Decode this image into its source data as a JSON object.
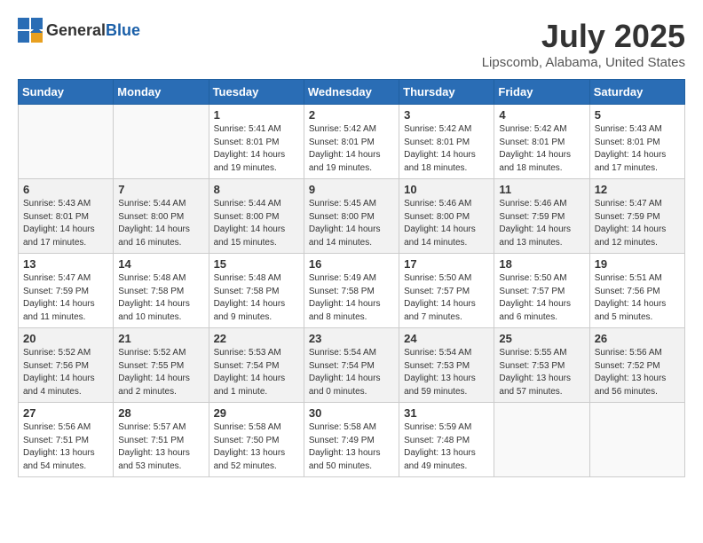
{
  "header": {
    "logo_general": "General",
    "logo_blue": "Blue",
    "title": "July 2025",
    "location": "Lipscomb, Alabama, United States"
  },
  "weekdays": [
    "Sunday",
    "Monday",
    "Tuesday",
    "Wednesday",
    "Thursday",
    "Friday",
    "Saturday"
  ],
  "weeks": [
    [
      {
        "day": "",
        "sunrise": "",
        "sunset": "",
        "daylight": ""
      },
      {
        "day": "",
        "sunrise": "",
        "sunset": "",
        "daylight": ""
      },
      {
        "day": "1",
        "sunrise": "Sunrise: 5:41 AM",
        "sunset": "Sunset: 8:01 PM",
        "daylight": "Daylight: 14 hours and 19 minutes."
      },
      {
        "day": "2",
        "sunrise": "Sunrise: 5:42 AM",
        "sunset": "Sunset: 8:01 PM",
        "daylight": "Daylight: 14 hours and 19 minutes."
      },
      {
        "day": "3",
        "sunrise": "Sunrise: 5:42 AM",
        "sunset": "Sunset: 8:01 PM",
        "daylight": "Daylight: 14 hours and 18 minutes."
      },
      {
        "day": "4",
        "sunrise": "Sunrise: 5:42 AM",
        "sunset": "Sunset: 8:01 PM",
        "daylight": "Daylight: 14 hours and 18 minutes."
      },
      {
        "day": "5",
        "sunrise": "Sunrise: 5:43 AM",
        "sunset": "Sunset: 8:01 PM",
        "daylight": "Daylight: 14 hours and 17 minutes."
      }
    ],
    [
      {
        "day": "6",
        "sunrise": "Sunrise: 5:43 AM",
        "sunset": "Sunset: 8:01 PM",
        "daylight": "Daylight: 14 hours and 17 minutes."
      },
      {
        "day": "7",
        "sunrise": "Sunrise: 5:44 AM",
        "sunset": "Sunset: 8:00 PM",
        "daylight": "Daylight: 14 hours and 16 minutes."
      },
      {
        "day": "8",
        "sunrise": "Sunrise: 5:44 AM",
        "sunset": "Sunset: 8:00 PM",
        "daylight": "Daylight: 14 hours and 15 minutes."
      },
      {
        "day": "9",
        "sunrise": "Sunrise: 5:45 AM",
        "sunset": "Sunset: 8:00 PM",
        "daylight": "Daylight: 14 hours and 14 minutes."
      },
      {
        "day": "10",
        "sunrise": "Sunrise: 5:46 AM",
        "sunset": "Sunset: 8:00 PM",
        "daylight": "Daylight: 14 hours and 14 minutes."
      },
      {
        "day": "11",
        "sunrise": "Sunrise: 5:46 AM",
        "sunset": "Sunset: 7:59 PM",
        "daylight": "Daylight: 14 hours and 13 minutes."
      },
      {
        "day": "12",
        "sunrise": "Sunrise: 5:47 AM",
        "sunset": "Sunset: 7:59 PM",
        "daylight": "Daylight: 14 hours and 12 minutes."
      }
    ],
    [
      {
        "day": "13",
        "sunrise": "Sunrise: 5:47 AM",
        "sunset": "Sunset: 7:59 PM",
        "daylight": "Daylight: 14 hours and 11 minutes."
      },
      {
        "day": "14",
        "sunrise": "Sunrise: 5:48 AM",
        "sunset": "Sunset: 7:58 PM",
        "daylight": "Daylight: 14 hours and 10 minutes."
      },
      {
        "day": "15",
        "sunrise": "Sunrise: 5:48 AM",
        "sunset": "Sunset: 7:58 PM",
        "daylight": "Daylight: 14 hours and 9 minutes."
      },
      {
        "day": "16",
        "sunrise": "Sunrise: 5:49 AM",
        "sunset": "Sunset: 7:58 PM",
        "daylight": "Daylight: 14 hours and 8 minutes."
      },
      {
        "day": "17",
        "sunrise": "Sunrise: 5:50 AM",
        "sunset": "Sunset: 7:57 PM",
        "daylight": "Daylight: 14 hours and 7 minutes."
      },
      {
        "day": "18",
        "sunrise": "Sunrise: 5:50 AM",
        "sunset": "Sunset: 7:57 PM",
        "daylight": "Daylight: 14 hours and 6 minutes."
      },
      {
        "day": "19",
        "sunrise": "Sunrise: 5:51 AM",
        "sunset": "Sunset: 7:56 PM",
        "daylight": "Daylight: 14 hours and 5 minutes."
      }
    ],
    [
      {
        "day": "20",
        "sunrise": "Sunrise: 5:52 AM",
        "sunset": "Sunset: 7:56 PM",
        "daylight": "Daylight: 14 hours and 4 minutes."
      },
      {
        "day": "21",
        "sunrise": "Sunrise: 5:52 AM",
        "sunset": "Sunset: 7:55 PM",
        "daylight": "Daylight: 14 hours and 2 minutes."
      },
      {
        "day": "22",
        "sunrise": "Sunrise: 5:53 AM",
        "sunset": "Sunset: 7:54 PM",
        "daylight": "Daylight: 14 hours and 1 minute."
      },
      {
        "day": "23",
        "sunrise": "Sunrise: 5:54 AM",
        "sunset": "Sunset: 7:54 PM",
        "daylight": "Daylight: 14 hours and 0 minutes."
      },
      {
        "day": "24",
        "sunrise": "Sunrise: 5:54 AM",
        "sunset": "Sunset: 7:53 PM",
        "daylight": "Daylight: 13 hours and 59 minutes."
      },
      {
        "day": "25",
        "sunrise": "Sunrise: 5:55 AM",
        "sunset": "Sunset: 7:53 PM",
        "daylight": "Daylight: 13 hours and 57 minutes."
      },
      {
        "day": "26",
        "sunrise": "Sunrise: 5:56 AM",
        "sunset": "Sunset: 7:52 PM",
        "daylight": "Daylight: 13 hours and 56 minutes."
      }
    ],
    [
      {
        "day": "27",
        "sunrise": "Sunrise: 5:56 AM",
        "sunset": "Sunset: 7:51 PM",
        "daylight": "Daylight: 13 hours and 54 minutes."
      },
      {
        "day": "28",
        "sunrise": "Sunrise: 5:57 AM",
        "sunset": "Sunset: 7:51 PM",
        "daylight": "Daylight: 13 hours and 53 minutes."
      },
      {
        "day": "29",
        "sunrise": "Sunrise: 5:58 AM",
        "sunset": "Sunset: 7:50 PM",
        "daylight": "Daylight: 13 hours and 52 minutes."
      },
      {
        "day": "30",
        "sunrise": "Sunrise: 5:58 AM",
        "sunset": "Sunset: 7:49 PM",
        "daylight": "Daylight: 13 hours and 50 minutes."
      },
      {
        "day": "31",
        "sunrise": "Sunrise: 5:59 AM",
        "sunset": "Sunset: 7:48 PM",
        "daylight": "Daylight: 13 hours and 49 minutes."
      },
      {
        "day": "",
        "sunrise": "",
        "sunset": "",
        "daylight": ""
      },
      {
        "day": "",
        "sunrise": "",
        "sunset": "",
        "daylight": ""
      }
    ]
  ]
}
